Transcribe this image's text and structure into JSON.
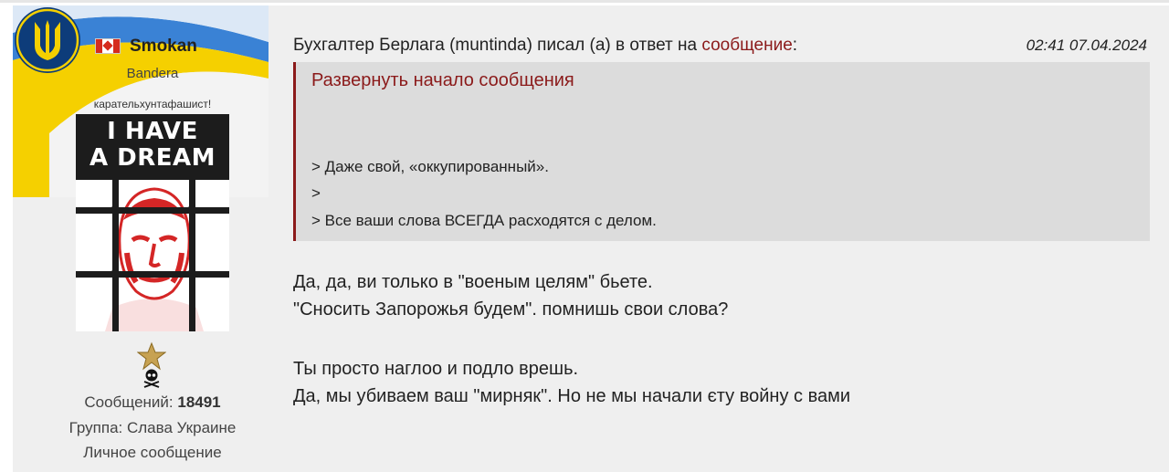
{
  "user": {
    "name": "Smokan",
    "title": "Bandera",
    "motto": "карательхунтафашист!",
    "flag_icon": "canada-flag-icon",
    "avatar_text": [
      "I HAVE",
      "A DREAM"
    ],
    "banner_colors": {
      "blue": "#1a6fd0",
      "yellow": "#f5d000"
    },
    "rank_icons": [
      "star-icon",
      "skull-icon"
    ],
    "messages_label": "Сообщений:",
    "messages_count": "18491",
    "group": "Группа: Слава Украине",
    "private_message": "Личное сообщение"
  },
  "post": {
    "header_prefix": "Бухгалтер Берлага (muntinda) писал (а) в ответ на ",
    "header_link": "сообщение",
    "header_suffix": ":",
    "date": "02:41 07.04.2024",
    "quote": {
      "expand_label": "Развернуть начало сообщения",
      "lines": [
        "> Даже свой, «оккупированный».",
        ">",
        "> Все ваши слова ВСЕГДА расходятся с делом."
      ]
    },
    "body": [
      "Да, да, ви только в \"военым целям\" бьете.",
      "\"Сносить Запорожья будем\". помнишь свои слова?",
      "Ты просто наглоо и подло врешь.",
      "Да, мы убиваем ваш \"мирняк\". Но не мы начали єту войну с вами"
    ]
  },
  "colors": {
    "link": "#8b1a1a",
    "post_bg": "#efefef",
    "quote_bg": "#dcdcdc"
  }
}
